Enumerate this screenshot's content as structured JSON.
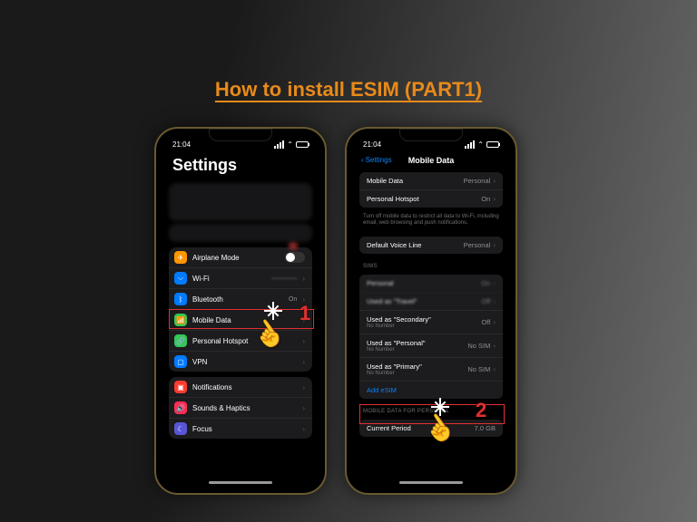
{
  "title": "How to install ESIM (PART1)",
  "step1_num": "1",
  "step2_num": "2",
  "phone1": {
    "time": "21:04",
    "header": "Settings",
    "airplane": "Airplane Mode",
    "wifi": "Wi-Fi",
    "bluetooth": "Bluetooth",
    "bluetooth_val": "On",
    "mobile_data": "Mobile Data",
    "hotspot": "Personal Hotspot",
    "vpn": "VPN",
    "notifications": "Notifications",
    "sounds": "Sounds & Haptics",
    "focus": "Focus"
  },
  "phone2": {
    "time": "21:04",
    "back": "Settings",
    "title": "Mobile Data",
    "md_label": "Mobile Data",
    "md_val": "Personal",
    "hotspot_label": "Personal Hotspot",
    "hotspot_val": "On",
    "footer1": "Turn off mobile data to restrict all data to Wi-Fi, including email, web browsing and push notifications.",
    "voice_label": "Default Voice Line",
    "voice_val": "Personal",
    "sims_header": "SIMs",
    "sim1_label": "Personal",
    "sim1_val": "On",
    "sim2_label": "Used as \"Travel\"",
    "sim2_val": "Off",
    "sim3_label": "Used as \"Secondary\"",
    "sim3_sub": "No Number",
    "sim3_val": "Off",
    "sim4_label": "Used as \"Personal\"",
    "sim4_sub": "No Number",
    "sim4_val": "No SIM",
    "sim5_label": "Used as \"Primary\"",
    "sim5_sub": "No Number",
    "sim5_val": "No SIM",
    "add_esim": "Add eSIM",
    "section2": "Mobile Data For Personal",
    "period_label": "Current Period",
    "period_val": "7.0 GB"
  }
}
